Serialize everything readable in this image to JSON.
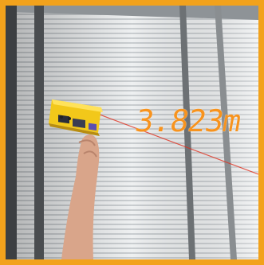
{
  "measurement": {
    "reading": "3.823m",
    "laser_color": "#e0301e",
    "display_color": "#f7931e"
  },
  "frame": {
    "border_color": "#f2a21c"
  },
  "scene": {
    "device_icon": "laser-distance-meter-icon",
    "hand_icon": "hand-icon"
  }
}
